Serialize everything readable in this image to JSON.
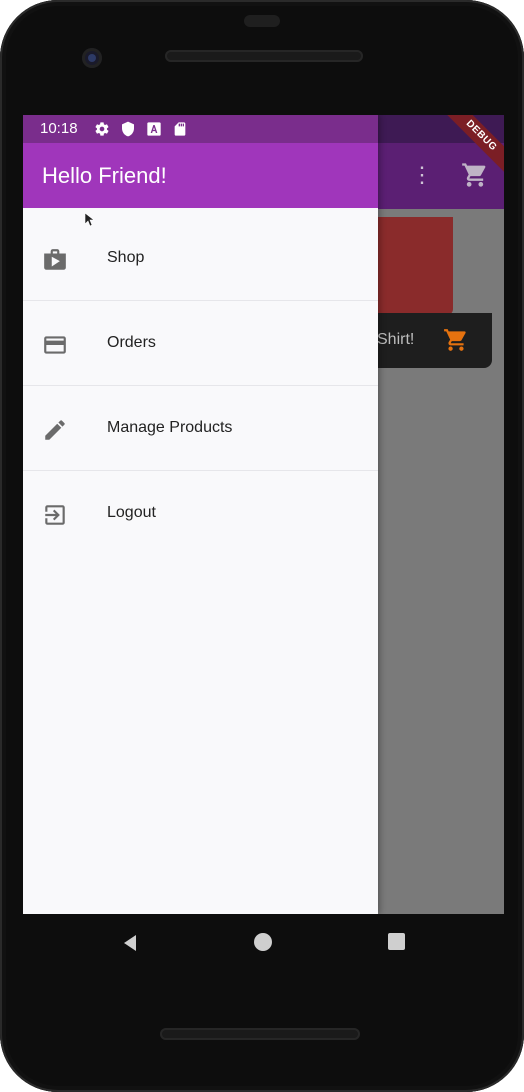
{
  "status_bar": {
    "time": "10:18"
  },
  "drawer": {
    "header_title": "Hello Friend!",
    "items": [
      {
        "label": "Shop",
        "icon": "shop-icon"
      },
      {
        "label": "Orders",
        "icon": "credit-card-icon"
      },
      {
        "label": "Manage Products",
        "icon": "edit-icon"
      },
      {
        "label": "Logout",
        "icon": "exit-icon"
      }
    ]
  },
  "background_app": {
    "product_title_partial": "Shirt!",
    "debug_banner": "DEBUG"
  },
  "colors": {
    "drawer_header": "#a036bb",
    "status_bar": "#7a2d8c",
    "scrim_appbar": "#5b1f73",
    "cart_accent": "#e5720f"
  }
}
